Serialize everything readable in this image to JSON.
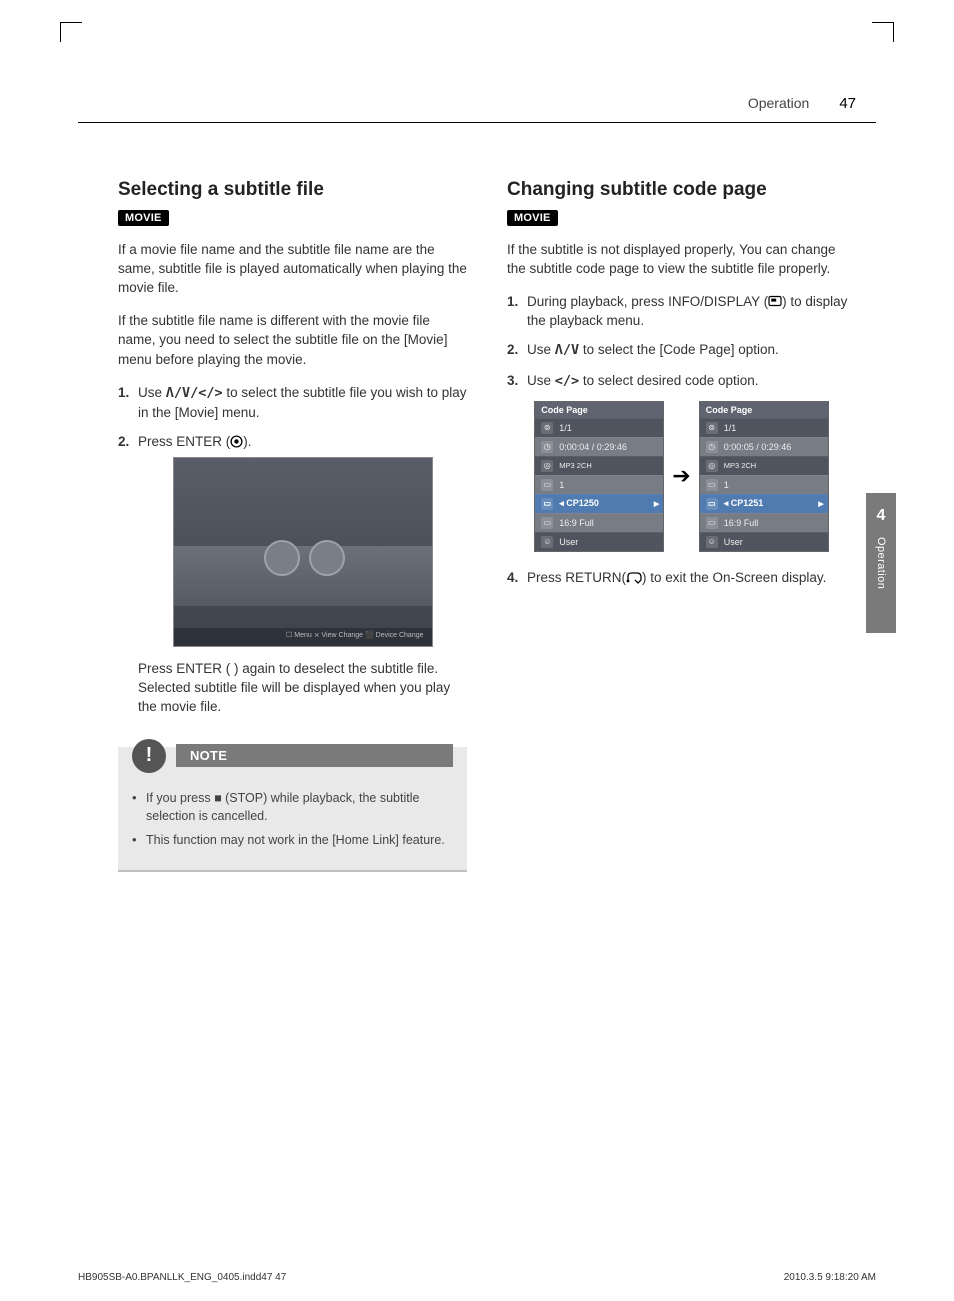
{
  "header": {
    "section": "Operation",
    "pageNumber": "47"
  },
  "sideTab": {
    "chapter": "4",
    "label": "Operation"
  },
  "left": {
    "heading": "Selecting a subtitle file",
    "tag": "MOVIE",
    "intro1": "If a movie file name and the subtitle file name are the same, subtitle file is played automatically when playing the movie file.",
    "intro2": "If the subtitle file name is different with the movie file name, you need to select the subtitle file on the [Movie] menu before playing the movie.",
    "step1a": "Use ",
    "step1b": " to select the subtitle file you wish to play in the [Movie] menu.",
    "step2a": "Press ENTER (",
    "step2b": ").",
    "screenshotToolbar": "☐ Menu    ⨯ View Change    ⬛ Device Change",
    "afterScreenshot": "Press ENTER (  ) again to deselect the subtitle file. Selected subtitle file will be displayed when you play the movie file.",
    "noteTitle": "NOTE",
    "noteItem1a": "If you press ",
    "noteItem1b": " (STOP) while playback, the subtitle selection is cancelled.",
    "noteItem2": "This function may not work in the [Home Link] feature."
  },
  "right": {
    "heading": "Changing subtitle code page",
    "tag": "MOVIE",
    "intro": "If the subtitle is not displayed properly, You can change the subtitle code page to view the subtitle file properly.",
    "step1a": "During playback, press INFO/DISPLAY (",
    "step1b": ") to display the playback menu.",
    "step2a": "Use ",
    "step2b": " to select the [Code Page] option.",
    "step3a": "Use ",
    "step3b": " to select desired code option.",
    "step4a": "Press RETURN(",
    "step4b": ") to exit the On-Screen display.",
    "osd": {
      "title": "Code Page",
      "row1": "1/1",
      "row2a": "0:00:04 / 0:29:46",
      "row2b": "0:00:05 / 0:29:46",
      "row3top": "1",
      "row3sub": "MP3   2CH",
      "row4": "1",
      "row5a": "◂ CP1250",
      "row5b": "◂ CP1251",
      "row6": "16:9 Full",
      "row7": "User"
    }
  },
  "footer": {
    "left": "HB905SB-A0.BPANLLK_ENG_0405.indd47   47",
    "right": "2010.3.5   9:18:20 AM"
  },
  "glyphs": {
    "updownleftright": "Λ/V/</>",
    "updown": "Λ/V",
    "leftright": "</>",
    "stopSquare": "■"
  }
}
